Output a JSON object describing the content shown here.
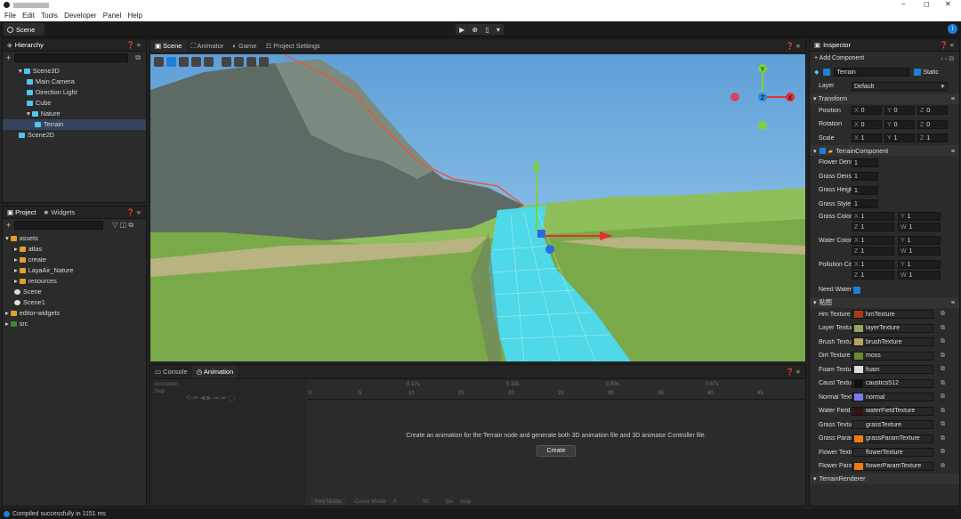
{
  "window": {
    "title": "",
    "minimize": "–",
    "maximize": "◻",
    "close": "✕"
  },
  "menu": [
    "File",
    "Edit",
    "Tools",
    "Developer",
    "Panel",
    "Help"
  ],
  "doc_tab": "Scene",
  "playbar": {
    "play": "▶",
    "net": "⊕",
    "device": "▯",
    "more": "▾"
  },
  "hierarchy": {
    "title": "Hierarchy",
    "items": [
      {
        "label": "Scene3D",
        "depth": 0
      },
      {
        "label": "Main Camera",
        "depth": 1
      },
      {
        "label": "Direction Light",
        "depth": 1
      },
      {
        "label": "Cube",
        "depth": 1
      },
      {
        "label": "Nature",
        "depth": 1
      },
      {
        "label": "Terrain",
        "depth": 2
      },
      {
        "label": "Scene2D",
        "depth": 0
      }
    ]
  },
  "project": {
    "tab1": "Project",
    "tab2": "Widgets",
    "items": [
      {
        "label": "assets",
        "depth": 0
      },
      {
        "label": "atlas",
        "depth": 1
      },
      {
        "label": "create",
        "depth": 1
      },
      {
        "label": "LayaAir_Nature",
        "depth": 1
      },
      {
        "label": "resources",
        "depth": 1
      },
      {
        "label": "Scene",
        "depth": 1
      },
      {
        "label": "Scene1",
        "depth": 1
      },
      {
        "label": "editor-widgets",
        "depth": 0
      },
      {
        "label": "src",
        "depth": 0
      }
    ]
  },
  "scene_tabs": [
    "Scene",
    "Animator",
    "Game",
    "Project Settings"
  ],
  "bottom_tabs": [
    "Console",
    "Animation"
  ],
  "animation": {
    "label": "Animation",
    "sub": "Stop",
    "ruler": [
      "0",
      "5",
      "10",
      "15",
      "20",
      "25",
      "30",
      "35",
      "40",
      "45"
    ],
    "ruler_top": [
      "0.17s",
      "0.33s",
      "0.50s",
      "0.67s"
    ],
    "message": "Create an animation for the Terrain node and generate both 3D animation file and 3D animator Controller file.",
    "create": "Create",
    "key_mode": "Key Mode",
    "curve_mode": "Curve Mode",
    "fps": "fps",
    "loop": "loop",
    "frame": "0",
    "fps_val": "60"
  },
  "status": "Compiled successfully in 1151 ms",
  "inspector": {
    "title": "Inspector",
    "add_component": "+ Add Component",
    "node_name": "Terrain",
    "static": "Static",
    "layer_label": "Layer",
    "layer_value": "Default",
    "transform": "Transform",
    "rows": [
      {
        "label": "Position",
        "x": "0",
        "y": "0",
        "z": "0"
      },
      {
        "label": "Rotation",
        "x": "0",
        "y": "0",
        "z": "0"
      },
      {
        "label": "Scale",
        "x": "1",
        "y": "1",
        "z": "1"
      }
    ],
    "terrain_comp": "TerrainComponent",
    "props": [
      {
        "label": "Flower Densit",
        "value": "1"
      },
      {
        "label": "Grass Density",
        "value": "1"
      },
      {
        "label": "Grass Height",
        "value": "1"
      },
      {
        "label": "Grass Style",
        "value": "1"
      }
    ],
    "grass_color": {
      "label": "Grass Color",
      "x": "1",
      "y": "1",
      "z": "1",
      "w": "1"
    },
    "water_color": {
      "label": "Water Color",
      "x": "1",
      "y": "1",
      "z": "1",
      "w": "1"
    },
    "pollution_color": {
      "label": "Pollution Colo",
      "x": "1",
      "y": "1",
      "z": "1",
      "w": "1"
    },
    "need_water": "Need Water",
    "textures_section": "贴图",
    "textures": [
      {
        "label": "Hm Texture",
        "value": "hmTexture",
        "color": "#a83a20"
      },
      {
        "label": "Layer Texture",
        "value": "layerTexture",
        "color": "#8fa860"
      },
      {
        "label": "Brush Texture",
        "value": "brushTexture",
        "color": "#b8a060"
      },
      {
        "label": "Dirt Texture",
        "value": "moss",
        "color": "#6a8a30"
      },
      {
        "label": "Foam Texture",
        "value": "foam",
        "color": "#dddddd"
      },
      {
        "label": "Caust Texture",
        "value": "caustics512",
        "color": "#111111"
      },
      {
        "label": "Normal Textur",
        "value": "normal",
        "color": "#7b7bf0"
      },
      {
        "label": "Water Field Te",
        "value": "waterFieldTexture",
        "color": "#3a1010"
      },
      {
        "label": "Grass Texture",
        "value": "grassTexture",
        "color": "#2a2a2a"
      },
      {
        "label": "Grass Param",
        "value": "grassParamTexture",
        "color": "#f07a10"
      },
      {
        "label": "Flower Texture",
        "value": "flowerTexture",
        "color": "#2a2a2a"
      },
      {
        "label": "Flower Param",
        "value": "flowerParamTexture",
        "color": "#f07a10"
      }
    ],
    "renderer": "TerrainRenderer"
  },
  "colors": {
    "accent": "#1e7fd8",
    "water": "#4fd8e8",
    "grass": "#7fae4f",
    "sky": "#7ab8e8"
  }
}
